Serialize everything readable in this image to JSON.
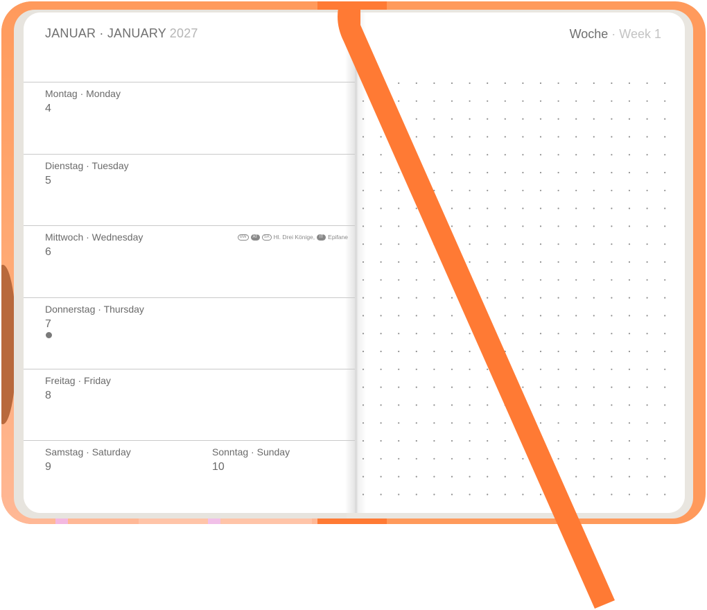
{
  "planner": {
    "month_de": "JANUAR",
    "separator": "·",
    "month_en": "JANUARY",
    "year": "2027",
    "week_de": "Woche",
    "week_en": "Week 1",
    "days": [
      {
        "name": "Montag · Monday",
        "number": "4"
      },
      {
        "name": "Dienstag · Tuesday",
        "number": "5"
      },
      {
        "name": "Mittwoch · Wednesday",
        "number": "6"
      },
      {
        "name": "Donnerstag · Thursday",
        "number": "7"
      },
      {
        "name": "Freitag · Friday",
        "number": "8"
      }
    ],
    "weekend": {
      "saturday_name": "Samstag · Saturday",
      "saturday_number": "9",
      "sunday_name": "Sonntag · Sunday",
      "sunday_number": "10"
    },
    "holiday": {
      "regions_1": [
        "BW",
        "AT",
        "SA"
      ],
      "text_1": "Hl. Drei Könige,",
      "region_2": "IT",
      "text_2": "Epifane"
    }
  },
  "colors": {
    "cover": "#ff9a5c",
    "ribbon": "#ff7a34",
    "dot": "#8f8f8f"
  }
}
